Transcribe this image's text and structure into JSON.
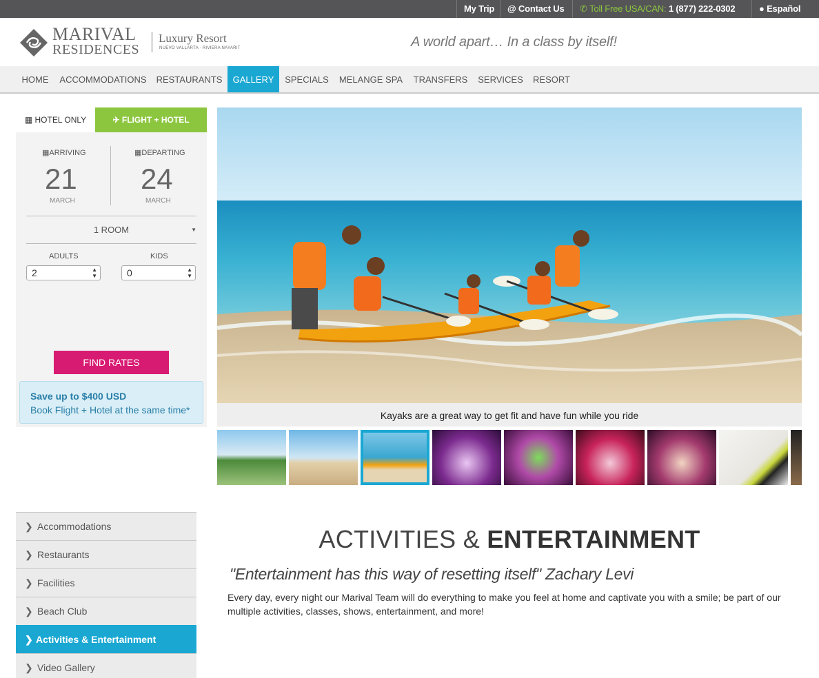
{
  "topbar": {
    "my_trip": "My Trip",
    "contact": "Contact Us",
    "toll_free_label": "Toll Free USA/CAN:",
    "toll_free_number": "1 (877) 222-0302",
    "language": "Español"
  },
  "header": {
    "brand_line1": "MARIVAL",
    "brand_line2": "RESIDENCES",
    "brand_luxury": "Luxury Resort",
    "brand_location": "NUEVO VALLARTA · RIVIERA NAYARIT",
    "tagline": "A world apart… In a class by itself!"
  },
  "nav": {
    "items": [
      "HOME",
      "ACCOMMODATIONS",
      "RESTAURANTS",
      "GALLERY",
      "SPECIALS",
      "MELANGE SPA",
      "TRANSFERS",
      "SERVICES",
      "RESORT"
    ],
    "active": "GALLERY"
  },
  "booking": {
    "tab_hotel": "HOTEL ONLY",
    "tab_flight": "FLIGHT + HOTEL",
    "arriving_label": "ARRIVING",
    "arriving_day": "21",
    "arriving_month": "MARCH",
    "departing_label": "DEPARTING",
    "departing_day": "24",
    "departing_month": "MARCH",
    "rooms": "1 ROOM",
    "adults_label": "ADULTS",
    "adults_value": "2",
    "kids_label": "KIDS",
    "kids_value": "0",
    "find_rates": "FIND RATES",
    "promo_line1": "Save up to $400 USD",
    "promo_line2": "Book Flight + Hotel at the same time*"
  },
  "gallery": {
    "caption": "Kayaks are a great way to get fit and have fun while you ride",
    "active_thumb": 3
  },
  "side_menu": {
    "items": [
      "Accommodations",
      "Restaurants",
      "Facilities",
      "Beach Club",
      "Activities & Entertainment",
      "Video Gallery"
    ],
    "active": "Activities & Entertainment"
  },
  "content": {
    "title_light": "ACTIVITIES &",
    "title_bold": "ENTERTAINMENT",
    "quote": "\"Entertainment has this way of resetting itself\" Zachary Levi",
    "body": "Every day, every night our Marival Team will do everything to make you feel at home and captivate you with a smile; be part of our multiple activities, classes, shows, entertainment, and more!"
  },
  "colors": {
    "accent_blue": "#1aa8d3",
    "flight_green": "#8cc63f",
    "button_pink": "#d81b72",
    "topbar": "#555558"
  }
}
